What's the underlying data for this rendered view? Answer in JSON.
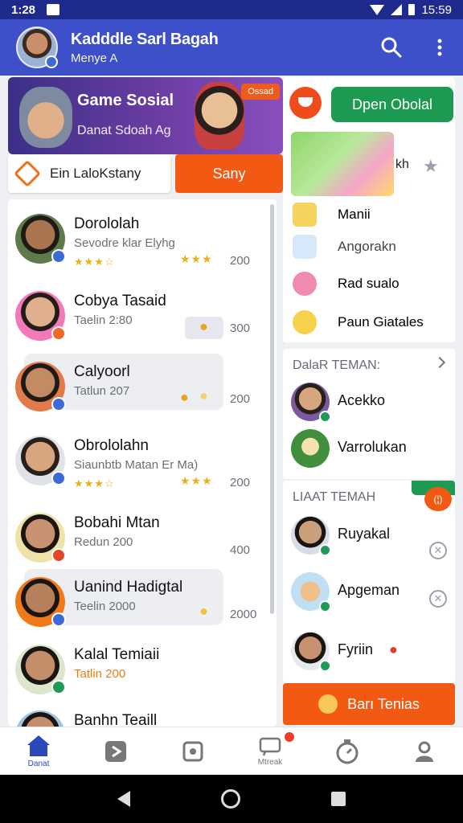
{
  "status": {
    "time": "1:28",
    "right_time": "15:59"
  },
  "appbar": {
    "title": "Kadddle Sarl Bagah",
    "subtitle": "Menye A"
  },
  "hero": {
    "title": "Game Sosial",
    "subtitle": "Danat Sdoah Ag",
    "tag": "Ossad"
  },
  "actions": {
    "left_button": "Ein LaloKstany",
    "right_button": "Sany"
  },
  "chats": [
    {
      "name": "Dorololah",
      "sub": "Sevodre klar Elyhg",
      "score": "200",
      "stars": "★★★☆",
      "rstars": "★★★"
    },
    {
      "name": "Cobya Tasaid",
      "sub": "Taelin  2:80",
      "score": "300"
    },
    {
      "name": "Calyoorl",
      "sub": "Tatlun  207",
      "score": "200"
    },
    {
      "name": "Obrololahn",
      "sub": "Siaunbtb Matan  Er Ma)",
      "score": "200",
      "stars": "★★★☆",
      "rstars": "★★★"
    },
    {
      "name": "Bobahi Mtan",
      "sub": "Redun  200",
      "score": "400"
    },
    {
      "name": "Uanind Hadigtal",
      "sub": "Teelin  2000",
      "score": "2000"
    },
    {
      "name": "Kalal Temiaii",
      "sub": "Tatlin  200",
      "score": ""
    },
    {
      "name": "Banhn Teaill",
      "sub": "",
      "score": ""
    }
  ],
  "panel1": {
    "open_button": "Dpen Obolal",
    "art_label": "kh",
    "items": [
      "Manii",
      "Angorakn",
      "Rad sualo",
      "Paun Giatales"
    ]
  },
  "friends_section": {
    "title": "DalaR TEMAN:",
    "friends": [
      "Acekko",
      "Varrolukan"
    ]
  },
  "suggest_section": {
    "title": "LIAAT TEMAH",
    "bubble": "(¦)",
    "friends": [
      "Ruyakal",
      "Apgeman",
      "Fyriin"
    ]
  },
  "add_button": "Barı Tenias",
  "bottomnav": [
    {
      "label": "Danat"
    },
    {
      "label": ""
    },
    {
      "label": ""
    },
    {
      "label": "Mtreak"
    },
    {
      "label": ""
    },
    {
      "label": ""
    }
  ],
  "colors": {
    "primary": "#3d4fc9",
    "accent": "#f25a14",
    "green": "#1d9a52"
  }
}
